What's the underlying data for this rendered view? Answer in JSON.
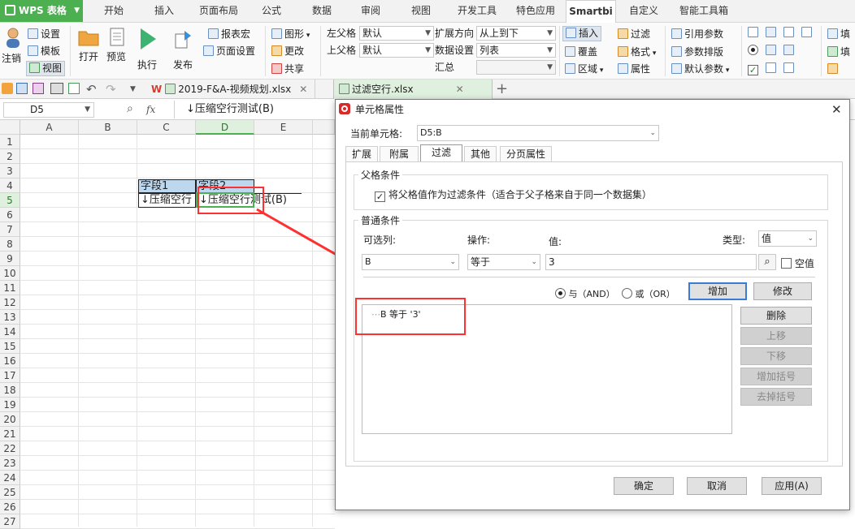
{
  "app": {
    "name": "WPS 表格"
  },
  "menu": {
    "tabs": [
      "开始",
      "插入",
      "页面布局",
      "公式",
      "数据",
      "审阅",
      "视图",
      "开发工具",
      "特色应用",
      "Smartbi",
      "自定义",
      "智能工具箱"
    ],
    "active": "Smartbi"
  },
  "ribbon": {
    "settings": "设置",
    "template": "模板",
    "view": "视图",
    "login": "注销",
    "open": "打开",
    "preview": "预览",
    "execute": "执行",
    "publish": "发布",
    "report_macro": "报表宏",
    "page_setup": "页面设置",
    "chart": "图形",
    "update": "更改",
    "share": "共享",
    "left_parent": "左父格",
    "left_parent_value": "默认",
    "top_parent": "上父格",
    "top_parent_value": "默认",
    "expand_dir": "扩展方向",
    "expand_dir_value": "从上到下",
    "data_setting": "数据设置",
    "data_setting_value": "列表",
    "summary": "汇总",
    "insert": "插入",
    "cover": "覆盖",
    "area": "区域",
    "filter": "过滤",
    "format": "格式",
    "property": "属性",
    "ref_param": "引用参数",
    "param_layout": "参数排版",
    "default_param": "默认参数",
    "fill1": "填",
    "fill2": "填"
  },
  "docs": [
    {
      "name": "2019-F&A-视频规划.xlsx"
    },
    {
      "name": "过滤空行.xlsx"
    }
  ],
  "formula": {
    "cell_ref": "D5",
    "fx": "fx",
    "value": "↓压缩空行测试(B)"
  },
  "sheet": {
    "columns": [
      "A",
      "B",
      "C",
      "D",
      "E"
    ],
    "rows": [
      "1",
      "2",
      "3",
      "4",
      "5",
      "6",
      "7",
      "8",
      "9",
      "10",
      "11",
      "12",
      "13",
      "14",
      "15",
      "16",
      "17",
      "18",
      "19",
      "20",
      "21",
      "22",
      "23",
      "24",
      "25",
      "26",
      "27"
    ],
    "c4": "字段1",
    "d4": "字段2",
    "c5": "↓压缩空行",
    "d5": "↓压缩空行测试(B)"
  },
  "dialog": {
    "title": "单元格属性",
    "current_cell_label": "当前单元格:",
    "current_cell_value": "D5:B",
    "tabs": [
      "扩展",
      "附属",
      "过滤",
      "其他",
      "分页属性"
    ],
    "active_tab": "过滤",
    "parent_group": "父格条件",
    "parent_checkbox": "将父格值作为过滤条件（适合于父子格来自于同一个数据集）",
    "normal_group": "普通条件",
    "col_label": "可选列:",
    "op_label": "操作:",
    "value_label": "值:",
    "type_label": "类型:",
    "type_value": "值",
    "col_value": "B",
    "op_value": "等于",
    "value_value": "3",
    "empty_value": "空值",
    "and_label": "与（AND）",
    "or_label": "或（OR）",
    "add": "增加",
    "modify": "修改",
    "delete": "删除",
    "move_up": "上移",
    "move_down": "下移",
    "add_bracket": "增加括号",
    "remove_bracket": "去掉括号",
    "condition_item": "B 等于 '3'",
    "ok": "确定",
    "cancel": "取消",
    "apply": "应用(A)"
  },
  "colors": {
    "accent": "#4caf50",
    "highlight": "#ff0000",
    "header_fill": "#bdd7ee"
  }
}
